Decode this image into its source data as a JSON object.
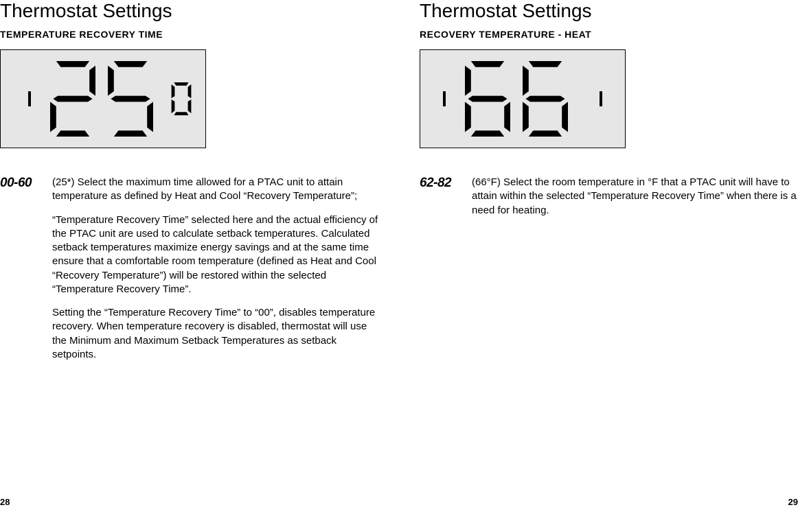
{
  "left": {
    "title": "Thermostat Settings",
    "section_label": "TEMPERATURE RECOVERY TIME",
    "display_value": "25",
    "display_small": "0",
    "range": "00-60",
    "desc_p1": "(25*) Select the maximum time allowed for a PTAC unit to attain temperature as defined by Heat and Cool “Recovery Temperature”;",
    "desc_p2": "“Temperature Recovery Time” selected here and the actual efficiency of the PTAC unit are used to calculate setback temperatures. Calculated setback temperatures maximize energy savings and at the same time ensure that a comfortable room temperature (defined as Heat and Cool “Recovery Temperature”) will be restored within the selected “Temperature Recovery Time”.",
    "desc_p3": "Setting the “Temperature Recovery Time” to “00”, disables temperature recovery. When temperature recovery is disabled, thermostat will use the Minimum and Maximum Setback Temperatures as setback setpoints.",
    "page_number": "28"
  },
  "right": {
    "title": "Thermostat Settings",
    "section_label": "RECOVERY TEMPERATURE - HEAT",
    "display_value": "66",
    "display_small": "1",
    "range": "62-82",
    "desc_p1": "(66°F) Select the room temperature in °F that a PTAC unit will have to attain within the selected “Temperature Recovery Time” when there is a need for heating.",
    "page_number": "29"
  }
}
